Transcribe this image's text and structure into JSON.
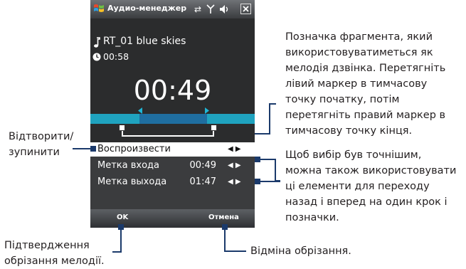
{
  "phone": {
    "title": "Аудио-менеджер",
    "song": "RT_01 blue skies",
    "duration": "00:58",
    "current_time": "00:49",
    "menu": [
      {
        "label": "Воспроизвести",
        "value": ""
      },
      {
        "label": "Метка входа",
        "value": "00:49"
      },
      {
        "label": "Метка выхода",
        "value": "01:47"
      }
    ],
    "softkeys": {
      "left": "OK",
      "right": "Отмена"
    }
  },
  "callouts": {
    "marker_desc": [
      "Позначка фрагмента, який",
      "використовуватиметься як",
      "мелодія дзвінка. Перетягніть",
      "лівий маркер в тимчасову",
      "точку початку, потім",
      "перетягніть правий маркер в",
      "тимчасову точку кінця."
    ],
    "play_stop": [
      "Відтворити/",
      "зупинити"
    ],
    "precision": [
      "Щоб вибір був точнішим,",
      "можна також використовувати",
      "ці елементи для переходу",
      "назад і вперед на один крок і",
      "позначки."
    ],
    "confirm": [
      "Підтвердження",
      "обрізання мелодії."
    ],
    "cancel": "Відміна обрізання."
  }
}
